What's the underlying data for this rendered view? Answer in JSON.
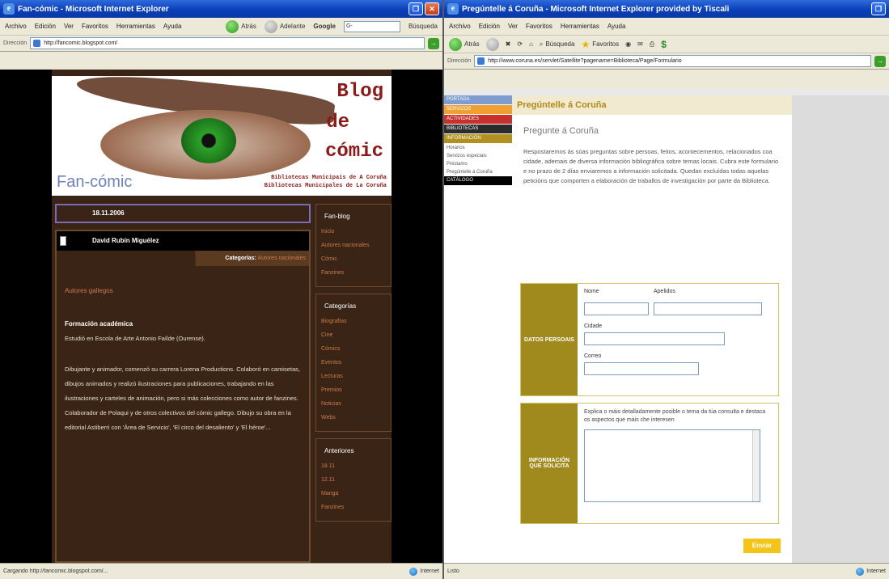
{
  "left": {
    "titlebar": {
      "title": "Fan-cómic - Microsoft Internet Explorer"
    },
    "menu": [
      "Archivo",
      "Edición",
      "Ver",
      "Favoritos",
      "Herramientas",
      "Ayuda"
    ],
    "toolbar": {
      "back_label": "Atrás",
      "forward_label": "Adelante",
      "search_brand": "Google",
      "search_value": "G-",
      "search_btn": "Búsqueda"
    },
    "address": {
      "label": "Dirección",
      "url": "http://fancomic.blogspot.com/"
    },
    "blog": {
      "title_lines": [
        "Blog",
        "de",
        "cómic"
      ],
      "brand": "Fan-cómic",
      "lib_lines": [
        "Bibliotecas Municipais de A Coruña",
        "Bibliotecas Municipales de La Coruña"
      ],
      "date": "18.11.2006",
      "post_title": "David Rubín Miguélez",
      "category_label": "Categorías:",
      "category_value": "Autores nacionales",
      "post_link": "Autores gallegos",
      "section_heading": "Formación académica",
      "section_text": "Estudió en Escola de Arte Antonio Faílde (Ourense).",
      "paragraph": "Dibujante y animador, comenzó su carrera Lorena Productions. Colaboró en camisetas, dibujos animados y realizó ilustraciones para publicaciones, trabajando en las ilustraciones y carteles de animación, pero si más colecciones como autor de fanzines. Colaborador de Polaqui y de otros colectivos del cómic gallego. Dibujo su obra en la editorial Astiberri con 'Área de Servicio', 'El circo del desaliento' y 'El héroe'..."
    },
    "sidebar": {
      "sections": [
        {
          "title": "Fan-blog",
          "items": [
            "Inicio",
            "Autores nacionales",
            "Cómic",
            "Fanzines"
          ]
        },
        {
          "title": "Categorías",
          "items": [
            "Biografías",
            "Cine",
            "Cómics",
            "Eventos",
            "Lecturas",
            "Premios",
            "Noticias",
            "Webs"
          ]
        },
        {
          "title": "Anteriores",
          "items": [
            "18.11",
            "12.11",
            "Manga",
            "Fanzines"
          ]
        }
      ]
    },
    "status": {
      "text": "Cargando http://fancomic.blogspot.com/...",
      "zone": "Internet"
    }
  },
  "right": {
    "titlebar": {
      "title": "Pregúntelle á Coruña - Microsoft Internet Explorer provided by Tiscali"
    },
    "menu": [
      "Archivo",
      "Edición",
      "Ver",
      "Favoritos",
      "Herramientas",
      "Ayuda"
    ],
    "toolbar": {
      "back_label": "Atrás",
      "search_label": "Búsqueda",
      "favorites_label": "Favoritos"
    },
    "address": {
      "label": "Dirección",
      "url": "http://www.coruna.es/servlet/Satellite?pagename=Biblioteca/Page/Formulario"
    },
    "nav": {
      "bars": [
        {
          "label": "PORTADA",
          "color": "#7e9ccf"
        },
        {
          "label": "SERVIZOS",
          "color": "#f0a030"
        },
        {
          "label": "ACTIVIDADES",
          "color": "#c8302c"
        },
        {
          "label": "BIBLIOTECAS",
          "color": "#2b2b2b"
        },
        {
          "label": "INFORMACIÓN",
          "color": "#b09020"
        }
      ],
      "subitems": [
        "Horarios",
        "Servizos especiais",
        "Préstamo",
        "Pregúntelle á Coruña"
      ],
      "footer_bar": "CATÁLOGO"
    },
    "page": {
      "heading": "Pregúntelle á Coruña",
      "subheading": "Pregunte á Coruña",
      "intro": "Respostaremos ás súas preguntas sobre persoas, feitos, acontecementos, relacionados coa cidade, ademais de diversa información bibliográfica sobre temas locais. Cubra este formulario e no prazo de 2 días enviaremos a información solicitada. Quedan excluídas todas aquelas peticións que comporten a elaboración de traballos de investigación por parte da Biblioteca.",
      "personal": {
        "label": "DATOS PERSOAIS",
        "name": "Nome",
        "surname": "Apelidos",
        "city": "Cidade",
        "email": "Correo"
      },
      "info": {
        "label": "INFORMACIÓN QUE SOLICITA",
        "instructions": "Explica o máis detalladamente posible o tema da túa consulta e destaca os aspectos que máis che interesen"
      },
      "submit": "Enviar"
    },
    "status": {
      "text": "Listo",
      "zone": "Internet"
    }
  }
}
